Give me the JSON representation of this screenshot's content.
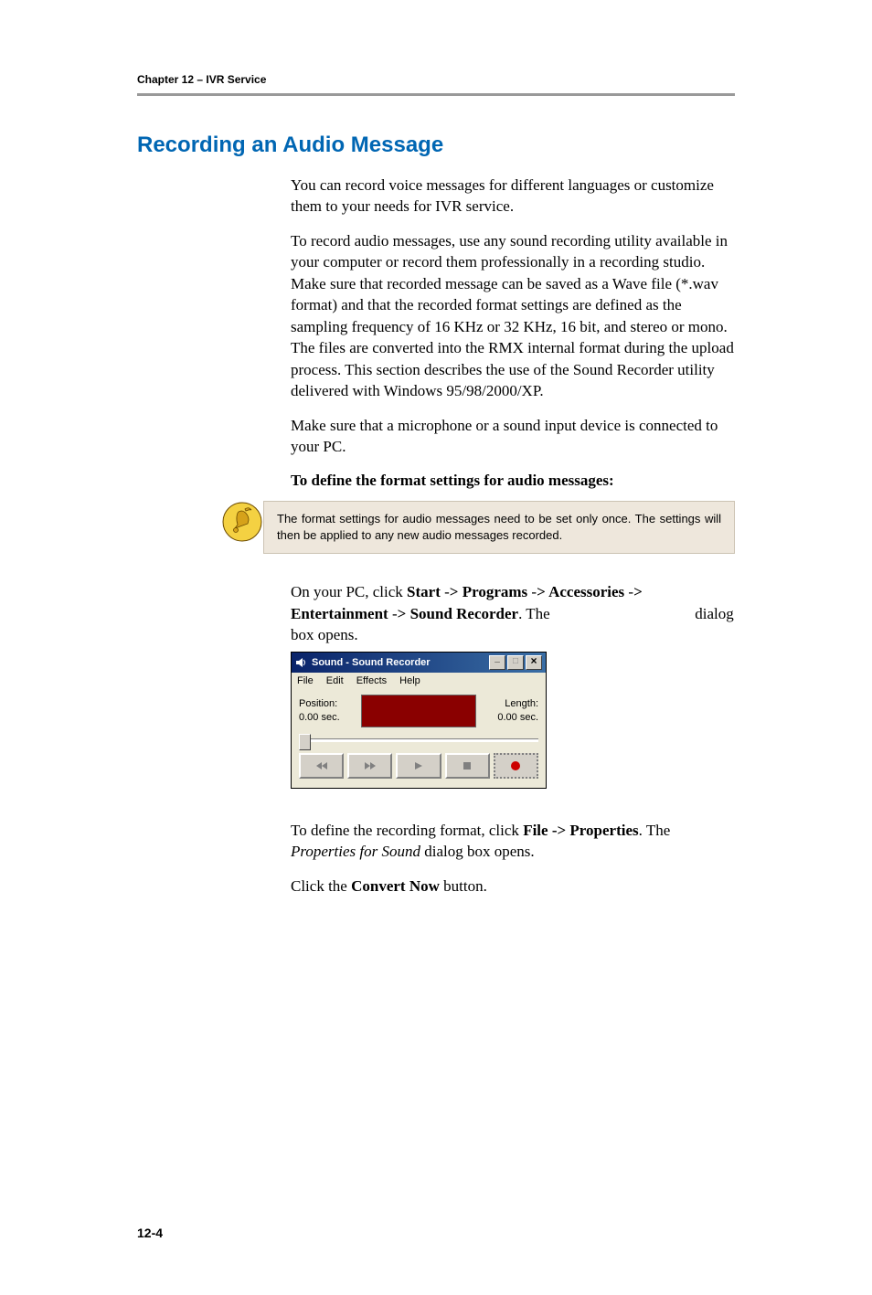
{
  "header": {
    "chapter": "Chapter 12 – IVR Service"
  },
  "title": "Recording an Audio Message",
  "intro": [
    "You can record voice messages for different languages or customize them to your needs for IVR service.",
    "To record audio messages, use any sound recording utility available in your computer or record them professionally in a recording studio. Make sure that recorded message can be saved as a Wave file (*.wav format) and that the recorded format settings are defined as the sampling frequency of 16 KHz or 32 KHz, 16 bit, and stereo or mono. The files are converted into the RMX internal format during the upload process. This section describes the use of the Sound Recorder utility delivered with Windows 95/98/2000/XP.",
    "Make sure that a microphone or a sound input device is connected to your PC."
  ],
  "subheading": "To define the format settings for audio messages:",
  "note": "The format settings for audio messages need to be set only once. The settings will then be applied to any new audio messages recorded.",
  "step1": {
    "prefix": "On your PC, click ",
    "b1": "Start",
    "s1": " -",
    "b2": "> Programs",
    "s2": " -",
    "b3": "> Accessories",
    "s3": " -",
    "b4": "> Entertainment",
    "s4": " -",
    "b5": "> Sound Recorder",
    "mid": ". The ",
    "tail": " dialog box opens."
  },
  "recorder": {
    "title": "Sound - Sound Recorder",
    "menu": {
      "file": "File",
      "edit": "Edit",
      "effects": "Effects",
      "help": "Help"
    },
    "pos_label": "Position:",
    "pos_value": "0.00 sec.",
    "len_label": "Length:",
    "len_value": "0.00 sec."
  },
  "step2": {
    "prefix": "To define the recording format, click ",
    "b1": "File -> Properties",
    "mid": ". The ",
    "i1": "Properties for Sound",
    "tail": " dialog box opens."
  },
  "step3": {
    "prefix": "Click the ",
    "b1": "Convert Now",
    "tail": " button."
  },
  "footer": "12-4"
}
